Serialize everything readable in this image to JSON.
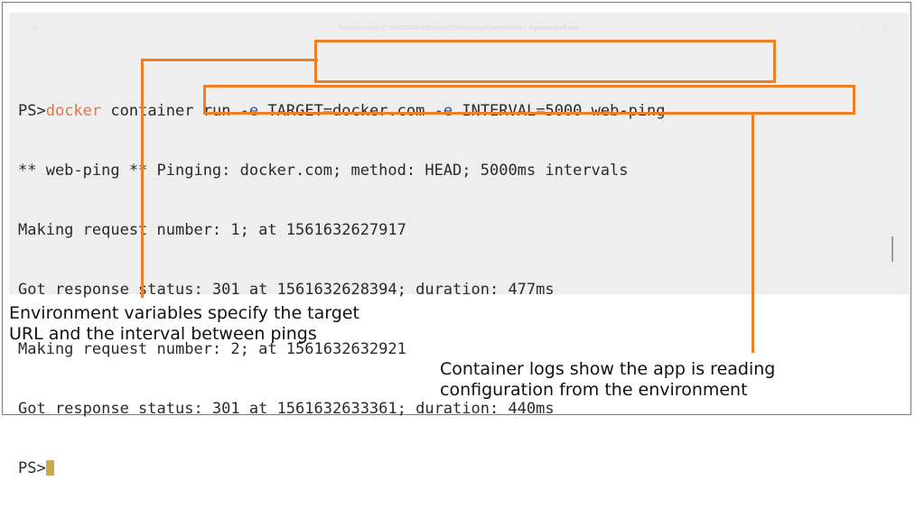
{
  "window": {
    "title": "Administrator: C:\\WINDOWS\\System32\\WindowsPowerShell\\v1.0\\powershell.exe",
    "minimize_glyph": "–",
    "maximize_glyph": "□",
    "close_glyph": "×"
  },
  "terminal": {
    "line1": {
      "prompt": "PS>",
      "command": "docker",
      "part1": " container run ",
      "flag1": "-e",
      "env1": " TARGET=docker.com ",
      "flag2": "-e",
      "env2": " INTERVAL=5000",
      "image": " web-ping"
    },
    "line2": "** web-ping ** Pinging: docker.com; method: HEAD; 5000ms intervals",
    "line3": "Making request number: 1; at 1561632627917",
    "line4": "Got response status: 301 at 1561632628394; duration: 477ms",
    "line5": "Making request number: 2; at 1561632632921",
    "line6": "Got response status: 301 at 1561632633361; duration: 440ms",
    "line7_prompt": "PS>"
  },
  "annotations": {
    "left_line1": "Environment variables specify the target",
    "left_line2": "URL and the interval between pings",
    "right_line1": "Container logs show the app is reading",
    "right_line2": "configuration from the environment",
    "highlight_color": "#ef7f23"
  }
}
